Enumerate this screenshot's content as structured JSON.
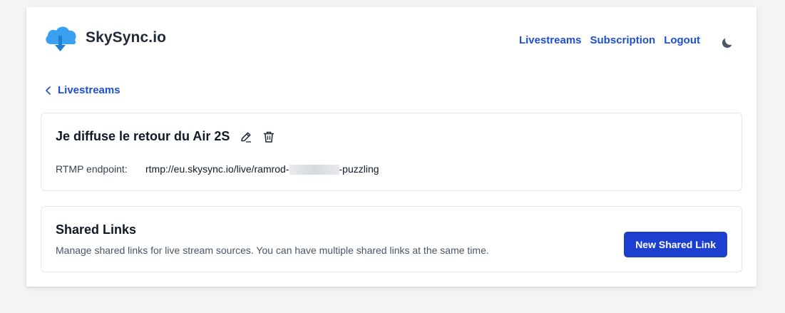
{
  "brand": {
    "name": "SkySync.io",
    "logo_icon": "cloud-upload-icon",
    "accent": "#1d4ed8",
    "logo_color": "#3aa0f0"
  },
  "nav": {
    "items": [
      "Livestreams",
      "Subscription",
      "Logout"
    ],
    "theme_icon": "moon-icon"
  },
  "breadcrumb": {
    "label": "Livestreams"
  },
  "stream": {
    "title": "Je diffuse le retour du Air 2S",
    "endpoint_label": "RTMP endpoint:",
    "endpoint_prefix": "rtmp://eu.skysync.io/live/ramrod-",
    "endpoint_suffix": "-puzzling"
  },
  "shared_links": {
    "title": "Shared Links",
    "description": "Manage shared links for live stream sources. You can have multiple shared links at the same time.",
    "button": "New Shared Link",
    "button_color": "#1d3fd0"
  }
}
